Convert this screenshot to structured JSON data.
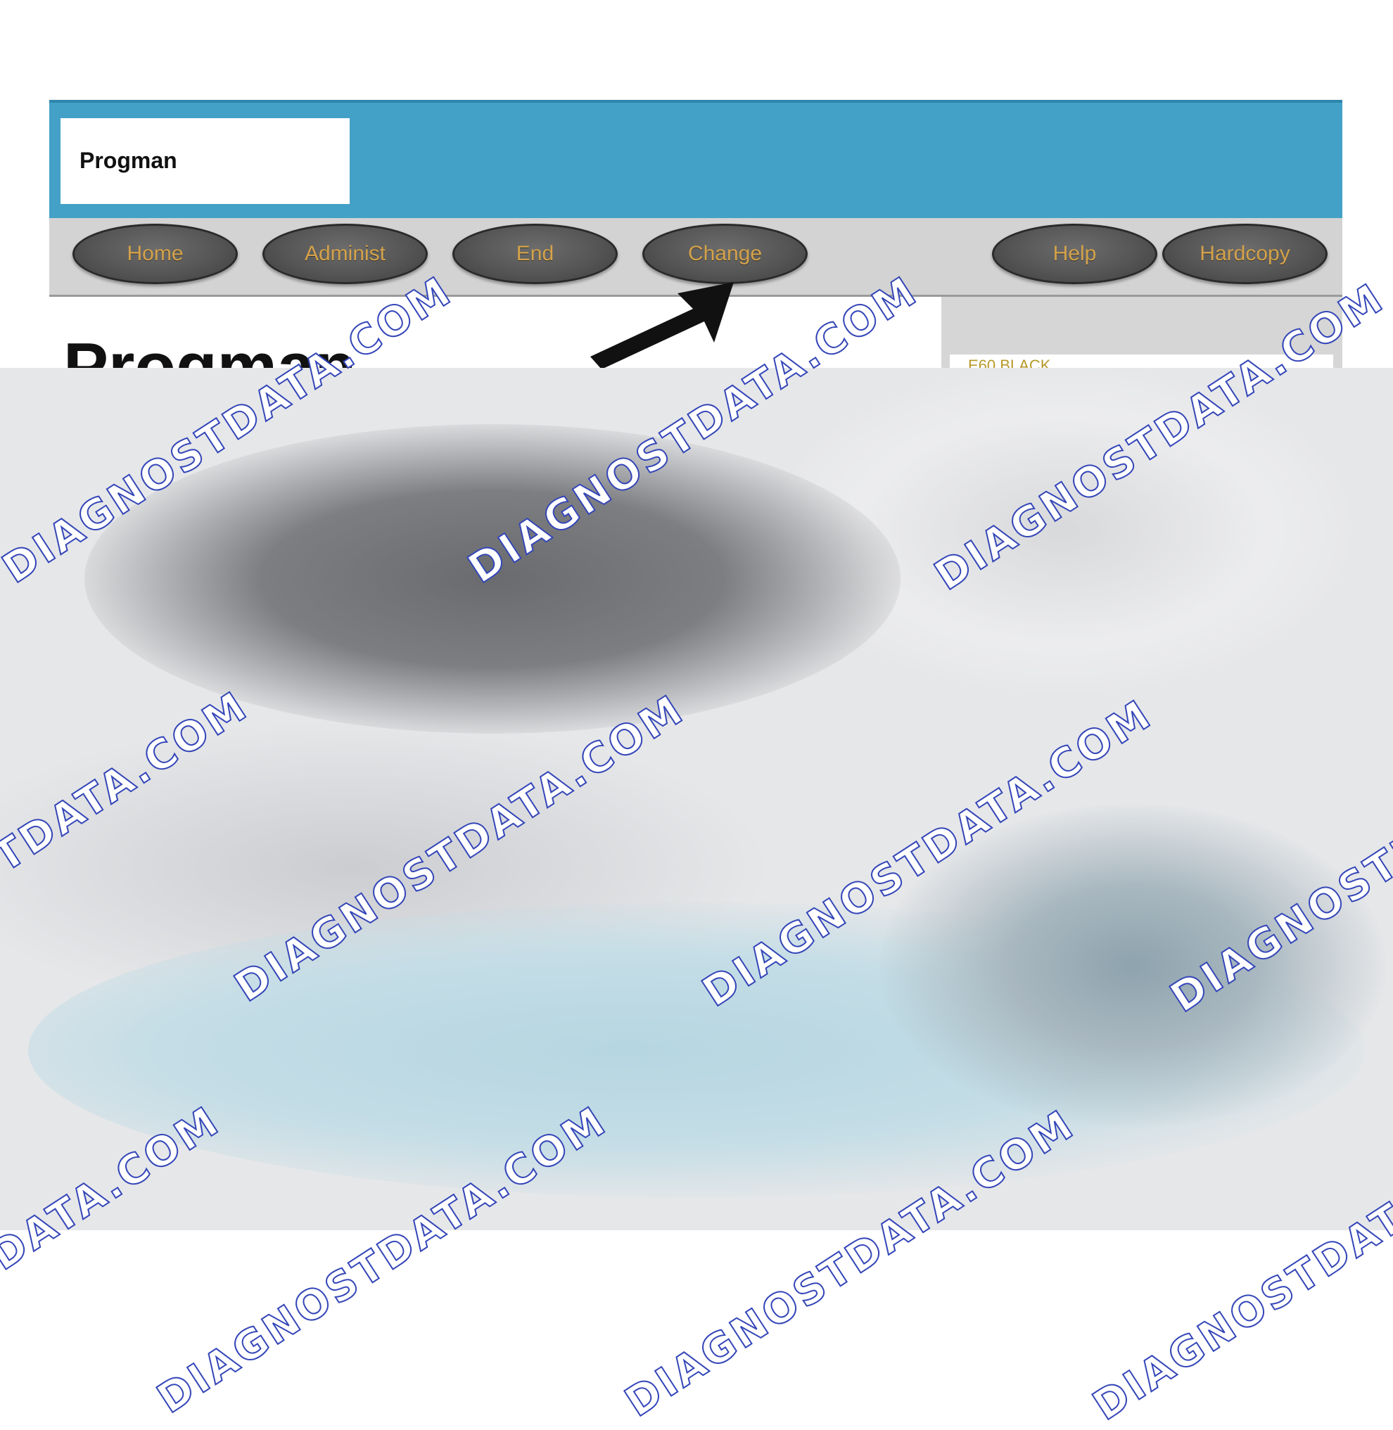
{
  "window": {
    "logo_text": "Progman",
    "page_title": "Progman"
  },
  "toolbar": {
    "buttons": [
      {
        "label": "Home"
      },
      {
        "label": "Administ"
      },
      {
        "label": "End"
      },
      {
        "label": "Change"
      },
      {
        "label": "Help"
      },
      {
        "label": "Hardcopy"
      }
    ]
  },
  "side_panel": {
    "field_text": "E60 BLACK"
  },
  "watermark": {
    "text": "DIAGNOSTDATA.COM"
  },
  "colors": {
    "header": "#43a0c6",
    "toolbar": "#d3d3d3",
    "button_fill": "#555555",
    "button_text": "#d4a24a",
    "watermark_outline": "#3446b8"
  }
}
